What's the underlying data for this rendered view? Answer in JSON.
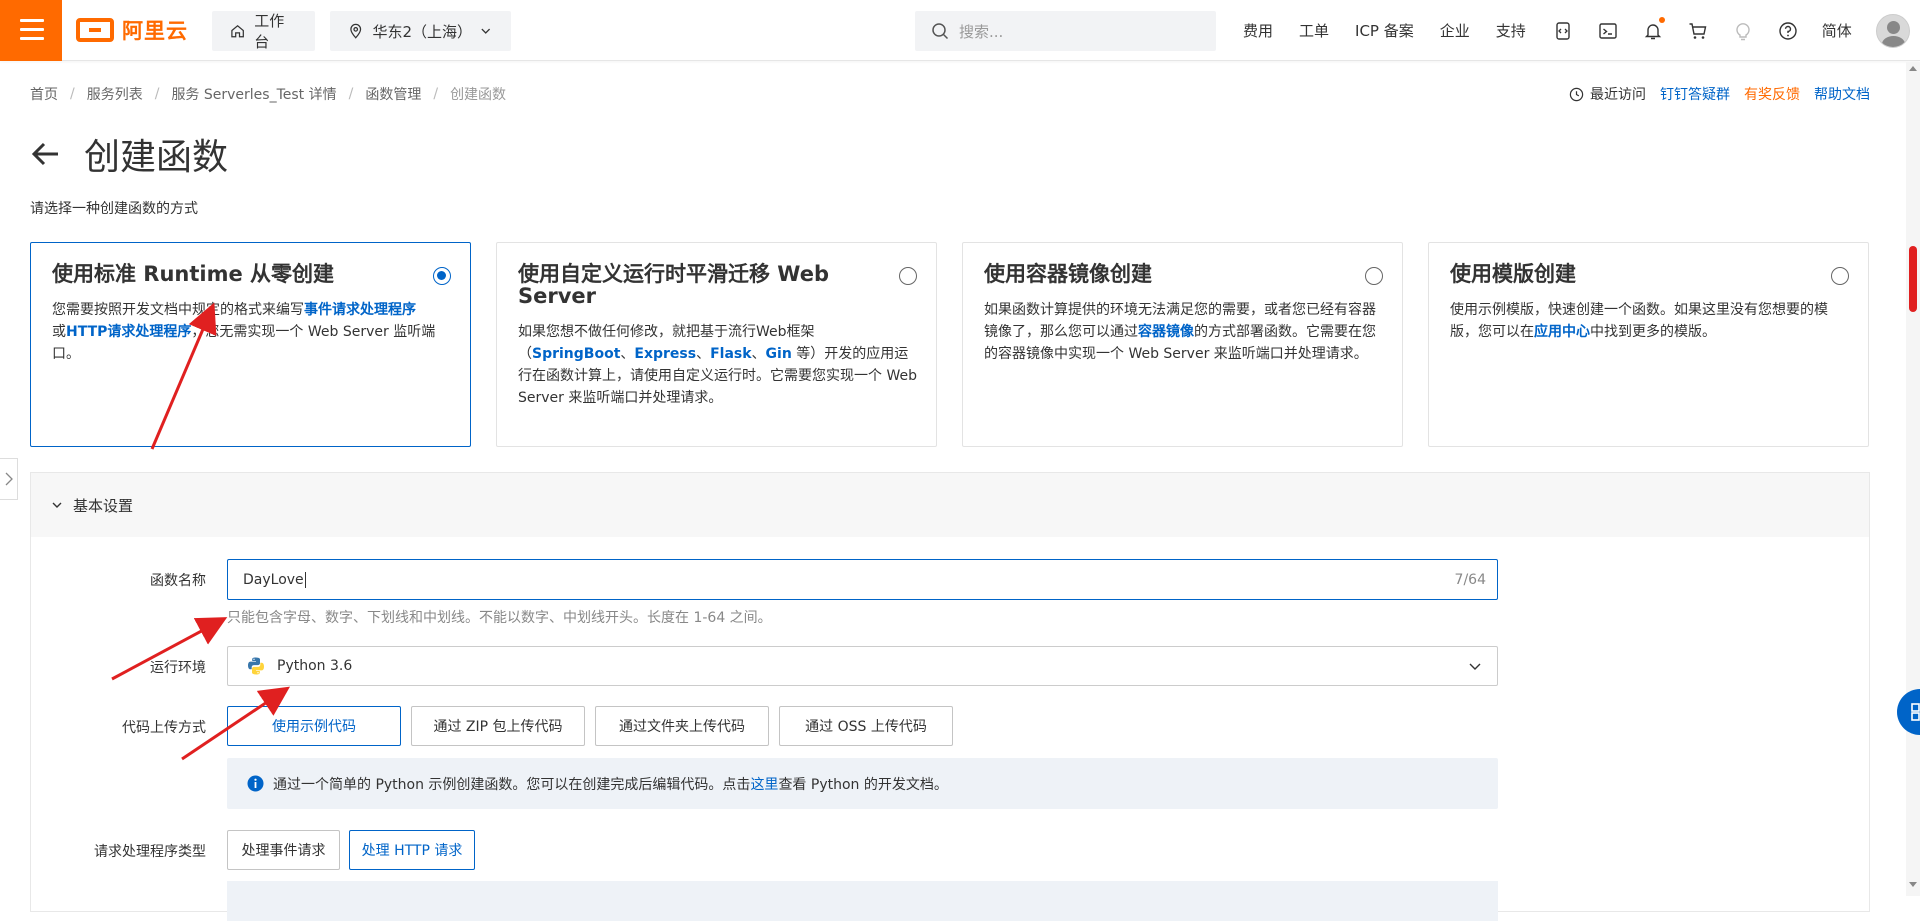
{
  "topbar": {
    "logo_text": "阿里云",
    "workbench": "工作台",
    "region": "华东2（上海）",
    "search_placeholder": "搜索...",
    "nav": [
      "费用",
      "工单",
      "ICP 备案",
      "企业",
      "支持"
    ],
    "lang": "简体"
  },
  "breadcrumb": {
    "items": [
      "首页",
      "服务列表",
      "服务 Serverles_Test 详情",
      "函数管理",
      "创建函数"
    ]
  },
  "top_links": {
    "recent": "最近访问",
    "dingtalk": "钉钉答疑群",
    "feedback": "有奖反馈",
    "help": "帮助文档"
  },
  "page": {
    "title": "创建函数",
    "subtitle": "请选择一种创建函数的方式"
  },
  "cards": [
    {
      "title": "使用标准 Runtime 从零创建",
      "desc_a": "您需要按照开发文档中规定的格式来编写",
      "desc_b": "事件请求处理程序",
      "desc_c": "或",
      "desc_d": "HTTP请求处理程序",
      "desc_e": "，您无需实现一个 Web Server 监听端口。"
    },
    {
      "title": "使用自定义运行时平滑迁移 Web Server",
      "desc_a": "如果您想不做任何修改，就把基于流行Web框架（",
      "desc_b": "SpringBoot",
      "desc_c": "、",
      "desc_d": "Express",
      "desc_e": "、",
      "desc_f": "Flask",
      "desc_g": "、",
      "desc_h": "Gin",
      "desc_i": " 等）开发的应用运行在函数计算上，请使用自定义运行时。它需要您实现一个 Web Server 来监听端口并处理请求。"
    },
    {
      "title": "使用容器镜像创建",
      "desc_a": "如果函数计算提供的环境无法满足您的需要，或者您已经有容器镜像了，那么您可以通过",
      "desc_b": "容器镜像",
      "desc_c": "的方式部署函数。它需要在您的容器镜像中实现一个 Web Server 来监听端口并处理请求。"
    },
    {
      "title": "使用模版创建",
      "desc_a": "使用示例模版，快速创建一个函数。如果这里没有您想要的模版，您可以在",
      "desc_b": "应用中心",
      "desc_c": "中找到更多的模版。"
    }
  ],
  "basic": {
    "section_title": "基本设置",
    "name_label": "函数名称",
    "name_value": "DayLove",
    "name_count": "7/64",
    "name_hint": "只能包含字母、数字、下划线和中划线。不能以数字、中划线开头。长度在 1-64 之间。",
    "runtime_label": "运行环境",
    "runtime_value": "Python 3.6",
    "upload_label": "代码上传方式",
    "upload_options": [
      "使用示例代码",
      "通过 ZIP 包上传代码",
      "通过文件夹上传代码",
      "通过 OSS 上传代码"
    ],
    "info_a": "通过一个简单的 Python 示例创建函数。您可以在创建完成后编辑代码。点击",
    "info_link": "这里",
    "info_b": "查看 Python 的开发文档。",
    "handler_label": "请求处理程序类型",
    "handler_options": [
      "处理事件请求",
      "处理 HTTP 请求"
    ]
  },
  "colors": {
    "accent": "#ff6a00",
    "primary": "#0064c8",
    "annotation": "#e02020"
  }
}
